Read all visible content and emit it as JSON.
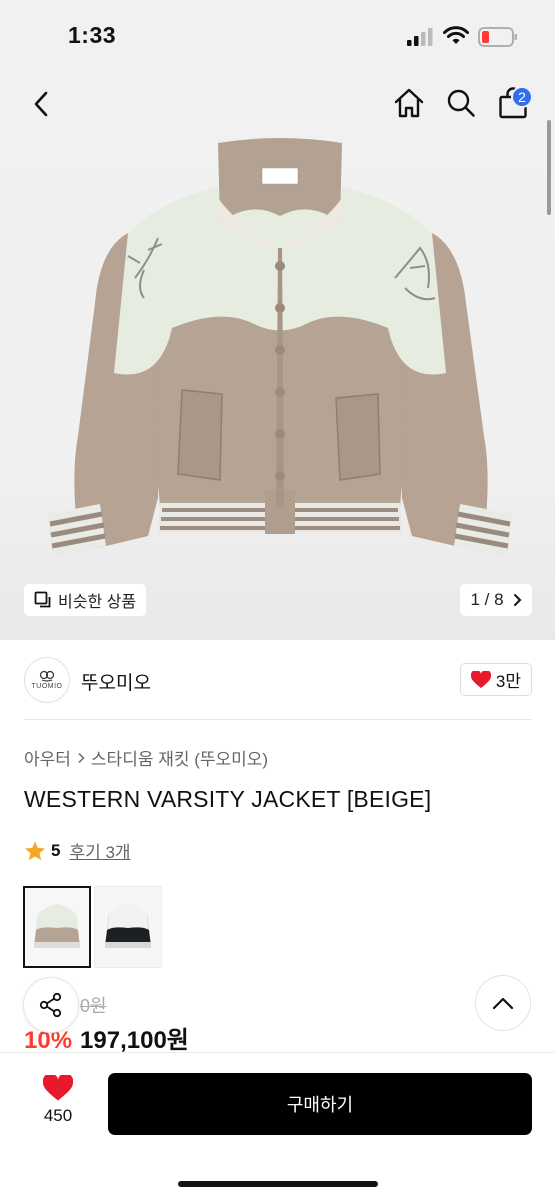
{
  "status_bar": {
    "time": "1:33"
  },
  "header": {
    "cart_count": "2"
  },
  "gallery": {
    "similar_label": "비슷한 상품",
    "counter": "1 / 8"
  },
  "brand": {
    "name": "뚜오미오",
    "logo_text": "TUOMIO",
    "like_count": "3만"
  },
  "breadcrumb": {
    "category": "아우터",
    "subcategory": "스타디움 재킷 (뚜오미오)"
  },
  "product": {
    "title": "WESTERN VARSITY JACKET [BEIGE]",
    "rating": "5",
    "review_label": "후기 3개",
    "original_price": "0원",
    "discount": "10%",
    "sale_price": "197,100원"
  },
  "thumbnails": [
    {
      "name": "beige",
      "selected": true
    },
    {
      "name": "black",
      "selected": false
    }
  ],
  "bottom_bar": {
    "wish_count": "450",
    "buy_label": "구매하기"
  },
  "colors": {
    "accent_blue": "#2f6fed",
    "discount_red": "#ff3b30",
    "heart_red": "#e8192c",
    "star": "#f5a623",
    "jacket_beige": "#b5a394",
    "jacket_cream": "#e9ecdf"
  },
  "icons": [
    "back-icon",
    "home-icon",
    "search-icon",
    "cart-icon",
    "copy-icon",
    "chevron-right-icon",
    "heart-icon",
    "star-icon",
    "share-icon",
    "chevron-up-icon"
  ]
}
